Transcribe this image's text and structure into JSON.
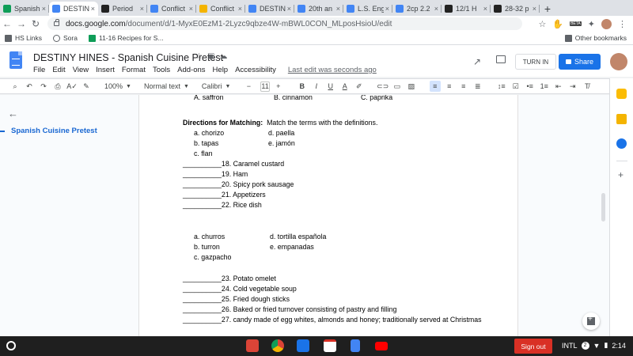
{
  "tabs": [
    {
      "label": "Spanish",
      "color": "#0f9d58",
      "active": false
    },
    {
      "label": "DESTINY",
      "color": "#4285f4",
      "active": true
    },
    {
      "label": "Period",
      "color": "#222222",
      "active": false
    },
    {
      "label": "Conflict",
      "color": "#4285f4",
      "active": false
    },
    {
      "label": "Conflict",
      "color": "#f4b400",
      "active": false
    },
    {
      "label": "DESTIN",
      "color": "#4285f4",
      "active": false
    },
    {
      "label": "20th an",
      "color": "#4285f4",
      "active": false
    },
    {
      "label": "L.S. Eng",
      "color": "#4285f4",
      "active": false
    },
    {
      "label": "2cp 2.2",
      "color": "#4285f4",
      "active": false
    },
    {
      "label": "12/1 H",
      "color": "#222222",
      "active": false
    },
    {
      "label": "28-32 p",
      "color": "#222222",
      "active": false
    }
  ],
  "browser": {
    "url_domain": "docs.google.com",
    "url_path": "/document/d/1-MyxE0EzM1-2Lyzc9qbze4W-mBWL0CON_MLposHsioU/edit",
    "beta_label": "BETA"
  },
  "bookmarks": {
    "items": [
      "HS Links",
      "Sora",
      "11-16 Recipes for S..."
    ],
    "other": "Other bookmarks"
  },
  "docs": {
    "title": "DESTINY HINES - Spanish Cuisine Pretest",
    "menus": [
      "File",
      "Edit",
      "View",
      "Insert",
      "Format",
      "Tools",
      "Add-ons",
      "Help",
      "Accessibility"
    ],
    "last_edit": "Last edit was seconds ago",
    "turn_in": "TURN IN",
    "share": "Share"
  },
  "toolbar": {
    "zoom": "100%",
    "style": "Normal text",
    "font": "Calibri",
    "font_size": "11"
  },
  "outline": {
    "heading": "Spanish Cuisine Pretest"
  },
  "document": {
    "top_cut": {
      "a": "A.   saffron",
      "b": "B.  cinnamon",
      "c": "C.  paprika"
    },
    "directions_label": "Directions for Matching:",
    "directions_text": "Match the terms with the definitions.",
    "set1_options": {
      "a": "a.   chorizo",
      "b": "b.   tapas",
      "c": "c.   flan",
      "d": "d.   paella",
      "e": "e. jamón"
    },
    "set1_items": [
      "__________18.  Caramel custard",
      "__________19.  Ham",
      "__________20.  Spicy pork sausage",
      "__________21.  Appetizers",
      "__________22.  Rice dish"
    ],
    "set2_options": {
      "a": "a.   churros",
      "b": "b.   turron",
      "c": "c.   gazpacho",
      "d": "d.   tortilla española",
      "e": "e.   empanadas"
    },
    "set2_items": [
      "__________23.  Potato omelet",
      "__________24.  Cold vegetable soup",
      "__________25.  Fried dough sticks",
      "__________26.  Baked or fried turnover consisting of pastry and filling",
      "__________27.  candy made of egg whites, almonds and honey; traditionally served at Christmas"
    ]
  },
  "shelf": {
    "sign_out": "Sign out",
    "input": "INTL",
    "notif_count": "2",
    "time": "2:14"
  }
}
